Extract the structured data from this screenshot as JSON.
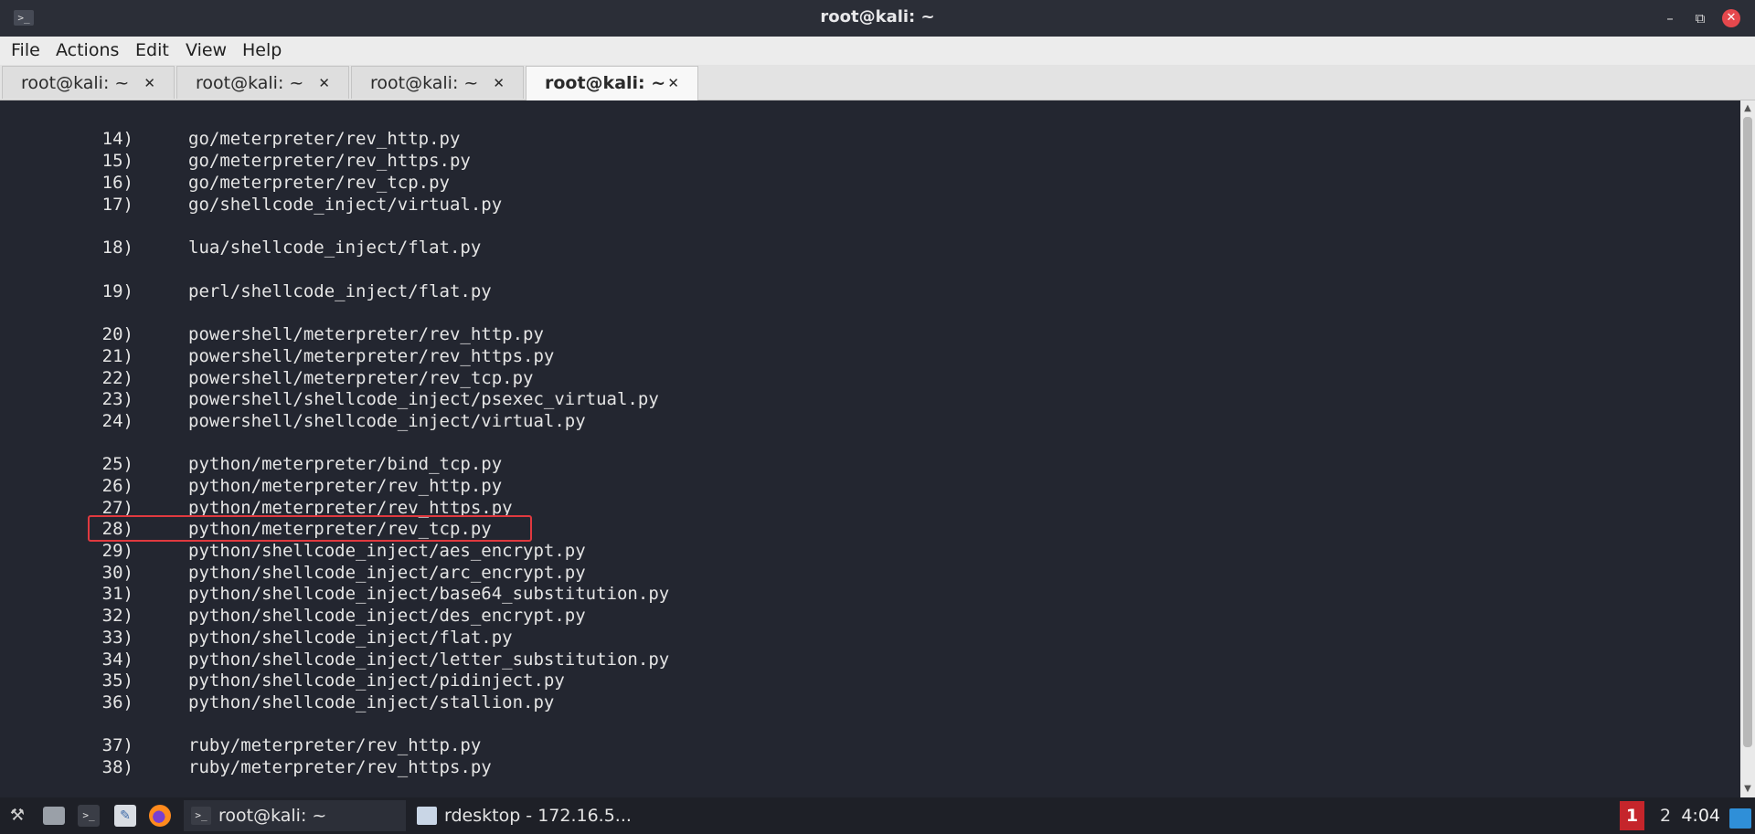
{
  "window": {
    "title": "root@kali: ~",
    "terminal_icon_glyph": ">_",
    "minimize_glyph": "–",
    "maximize_glyph": "⧉",
    "close_glyph": "✕"
  },
  "menu": [
    "File",
    "Actions",
    "Edit",
    "View",
    "Help"
  ],
  "tabs": [
    {
      "label": "root@kali: ~",
      "active": false
    },
    {
      "label": "root@kali: ~",
      "active": false
    },
    {
      "label": "root@kali: ~",
      "active": false
    },
    {
      "label": "root@kali: ~",
      "active": true
    }
  ],
  "tab_close_glyph": "✕",
  "terminal": {
    "highlighted_number": "28)",
    "highlight_color": "#e0393f",
    "lines": [
      {
        "num": "14)",
        "path": "go/meterpreter/rev_http.py"
      },
      {
        "num": "15)",
        "path": "go/meterpreter/rev_https.py"
      },
      {
        "num": "16)",
        "path": "go/meterpreter/rev_tcp.py"
      },
      {
        "num": "17)",
        "path": "go/shellcode_inject/virtual.py"
      },
      {
        "num": "18)",
        "path": "lua/shellcode_inject/flat.py"
      },
      {
        "num": "19)",
        "path": "perl/shellcode_inject/flat.py"
      },
      {
        "num": "20)",
        "path": "powershell/meterpreter/rev_http.py"
      },
      {
        "num": "21)",
        "path": "powershell/meterpreter/rev_https.py"
      },
      {
        "num": "22)",
        "path": "powershell/meterpreter/rev_tcp.py"
      },
      {
        "num": "23)",
        "path": "powershell/shellcode_inject/psexec_virtual.py"
      },
      {
        "num": "24)",
        "path": "powershell/shellcode_inject/virtual.py"
      },
      {
        "num": "25)",
        "path": "python/meterpreter/bind_tcp.py"
      },
      {
        "num": "26)",
        "path": "python/meterpreter/rev_http.py"
      },
      {
        "num": "27)",
        "path": "python/meterpreter/rev_https.py"
      },
      {
        "num": "28)",
        "path": "python/meterpreter/rev_tcp.py"
      },
      {
        "num": "29)",
        "path": "python/shellcode_inject/aes_encrypt.py"
      },
      {
        "num": "30)",
        "path": "python/shellcode_inject/arc_encrypt.py"
      },
      {
        "num": "31)",
        "path": "python/shellcode_inject/base64_substitution.py"
      },
      {
        "num": "32)",
        "path": "python/shellcode_inject/des_encrypt.py"
      },
      {
        "num": "33)",
        "path": "python/shellcode_inject/flat.py"
      },
      {
        "num": "34)",
        "path": "python/shellcode_inject/letter_substitution.py"
      },
      {
        "num": "35)",
        "path": "python/shellcode_inject/pidinject.py"
      },
      {
        "num": "36)",
        "path": "python/shellcode_inject/stallion.py"
      },
      {
        "num": "37)",
        "path": "ruby/meterpreter/rev_http.py"
      },
      {
        "num": "38)",
        "path": "ruby/meterpreter/rev_https.py"
      }
    ]
  },
  "taskbar": {
    "launchers": [
      "kali-menu-icon",
      "file-manager-icon",
      "terminal-icon",
      "text-editor-icon",
      "firefox-icon"
    ],
    "tasks": [
      {
        "label": "root@kali: ~",
        "icon": "terminal-icon"
      },
      {
        "label": "rdesktop - 172.16.5...",
        "icon": "rdesktop-icon"
      }
    ],
    "workspaces": [
      "1",
      "2"
    ],
    "active_workspace": "1",
    "clock": "4:04"
  }
}
